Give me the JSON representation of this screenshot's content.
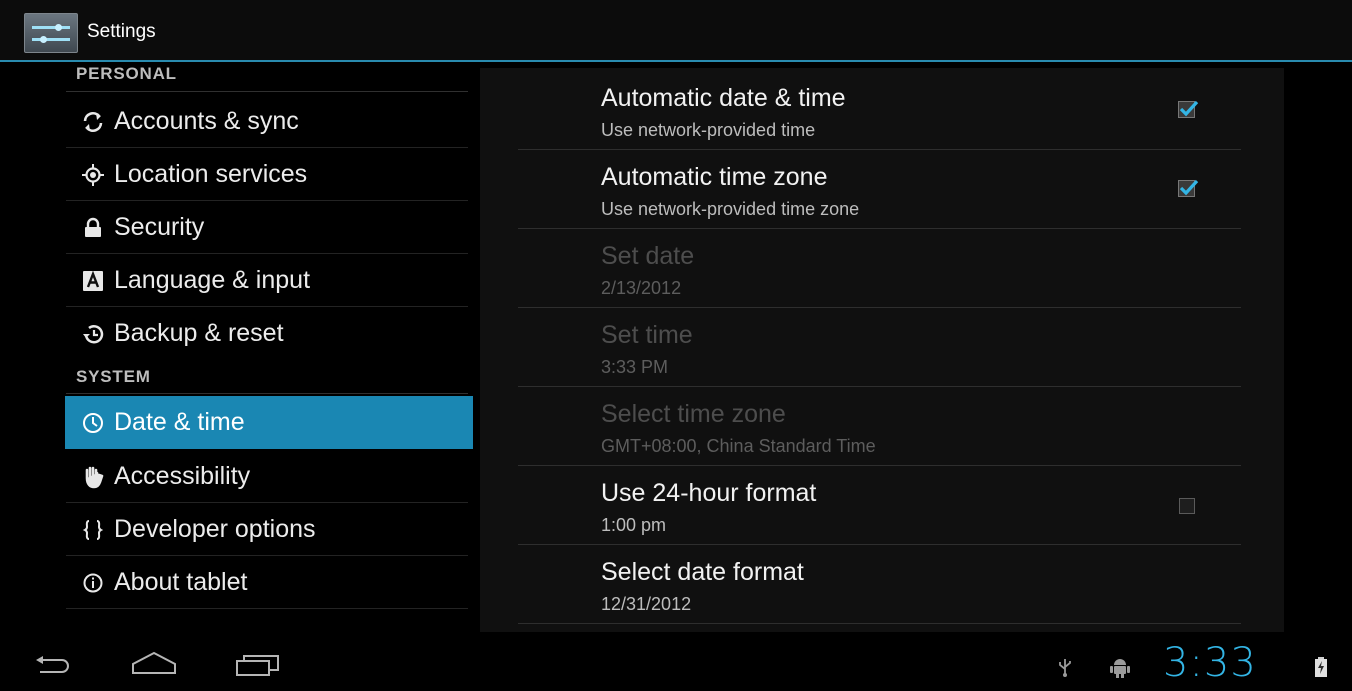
{
  "app": {
    "title": "Settings"
  },
  "sidebar": {
    "personal_header": "PERSONAL",
    "system_header": "SYSTEM",
    "items": [
      {
        "label": "Accounts & sync",
        "icon": "sync-icon"
      },
      {
        "label": "Location services",
        "icon": "location-icon"
      },
      {
        "label": "Security",
        "icon": "lock-icon"
      },
      {
        "label": "Language & input",
        "icon": "keyboard-a-icon"
      },
      {
        "label": "Backup & reset",
        "icon": "restore-icon"
      },
      {
        "label": "Date & time",
        "icon": "clock-icon",
        "selected": true
      },
      {
        "label": "Accessibility",
        "icon": "hand-icon"
      },
      {
        "label": "Developer options",
        "icon": "braces-icon"
      },
      {
        "label": "About tablet",
        "icon": "info-icon"
      }
    ]
  },
  "settings": [
    {
      "title": "Automatic date & time",
      "summary": "Use network-provided time",
      "checkbox": true,
      "checked": true,
      "enabled": true
    },
    {
      "title": "Automatic time zone",
      "summary": "Use network-provided time zone",
      "checkbox": true,
      "checked": true,
      "enabled": true
    },
    {
      "title": "Set date",
      "summary": "2/13/2012",
      "checkbox": false,
      "enabled": false
    },
    {
      "title": "Set time",
      "summary": "3:33 PM",
      "checkbox": false,
      "enabled": false
    },
    {
      "title": "Select time zone",
      "summary": "GMT+08:00, China Standard Time",
      "checkbox": false,
      "enabled": false
    },
    {
      "title": "Use 24-hour format",
      "summary": "1:00 pm",
      "checkbox": true,
      "checked": false,
      "enabled": true
    },
    {
      "title": "Select date format",
      "summary": "12/31/2012",
      "checkbox": false,
      "enabled": true
    }
  ],
  "statusbar": {
    "clock": "3:33"
  },
  "colors": {
    "accent": "#33b5e5",
    "selected_bg": "#1a87b3"
  }
}
